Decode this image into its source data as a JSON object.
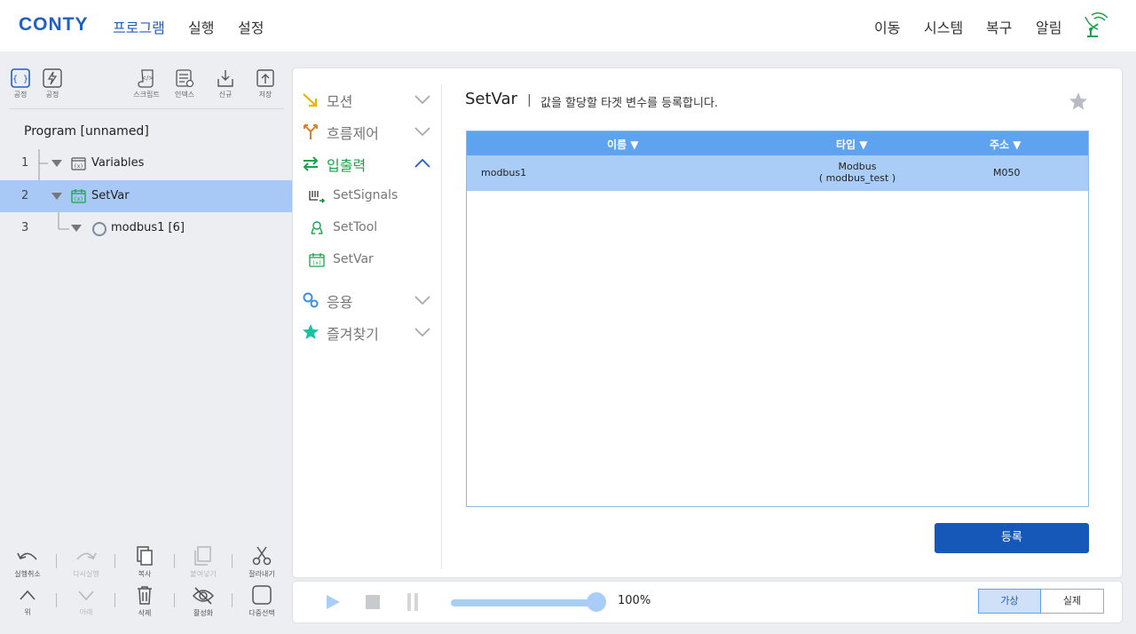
{
  "app": {
    "logo": "CONTY",
    "nav_left": [
      "프로그램",
      "실행",
      "설정"
    ],
    "nav_right": [
      "이동",
      "시스템",
      "복구",
      "알림"
    ]
  },
  "left_toolbar": {
    "mode_buttons": [
      "공정",
      "공정"
    ],
    "file_buttons": [
      "스크립트",
      "인덱스",
      "신규",
      "저장"
    ]
  },
  "program": {
    "title": "Program [unnamed]",
    "rows": [
      {
        "num": "1",
        "label": "Variables"
      },
      {
        "num": "2",
        "label": "SetVar"
      },
      {
        "num": "3",
        "label": "modbus1 [6]"
      }
    ]
  },
  "edit_tools": {
    "row1": [
      "실행취소",
      "다시실행",
      "복사",
      "붙여넣기",
      "잘라내기"
    ],
    "row2": [
      "위",
      "아래",
      "삭제",
      "활성화",
      "다중선택"
    ]
  },
  "commands": {
    "categories": [
      {
        "label": "모션",
        "open": false
      },
      {
        "label": "흐름제어",
        "open": false
      },
      {
        "label": "입출력",
        "open": true
      },
      {
        "label": "응용",
        "open": false
      },
      {
        "label": "즐겨찾기",
        "open": false
      }
    ],
    "io_items": [
      "SetSignals",
      "SetTool",
      "SetVar"
    ]
  },
  "detail": {
    "title": "SetVar",
    "separator": "|",
    "description": "값을 할당할 타겟 변수를 등록합니다.",
    "columns": [
      "이름 ▼",
      "타입 ▼",
      "주소 ▼"
    ],
    "rows": [
      {
        "name": "modbus1",
        "type_line1": "Modbus",
        "type_line2": "( modbus_test )",
        "address": "M050"
      }
    ],
    "register_button": "등록"
  },
  "controls": {
    "speed": "100%",
    "speed_fraction": 1.0,
    "modes": [
      "가상",
      "실제"
    ],
    "active_mode": "가상"
  },
  "colors": {
    "brand": "#1f5fc4",
    "selection": "#a8c9f5",
    "table_header": "#5ea3ef",
    "io_green": "#1aa34a",
    "motion_yellow": "#e8b400",
    "flow_orange": "#d9822b",
    "app_blue": "#3a8ee6",
    "favorite_teal": "#18c1a3"
  }
}
